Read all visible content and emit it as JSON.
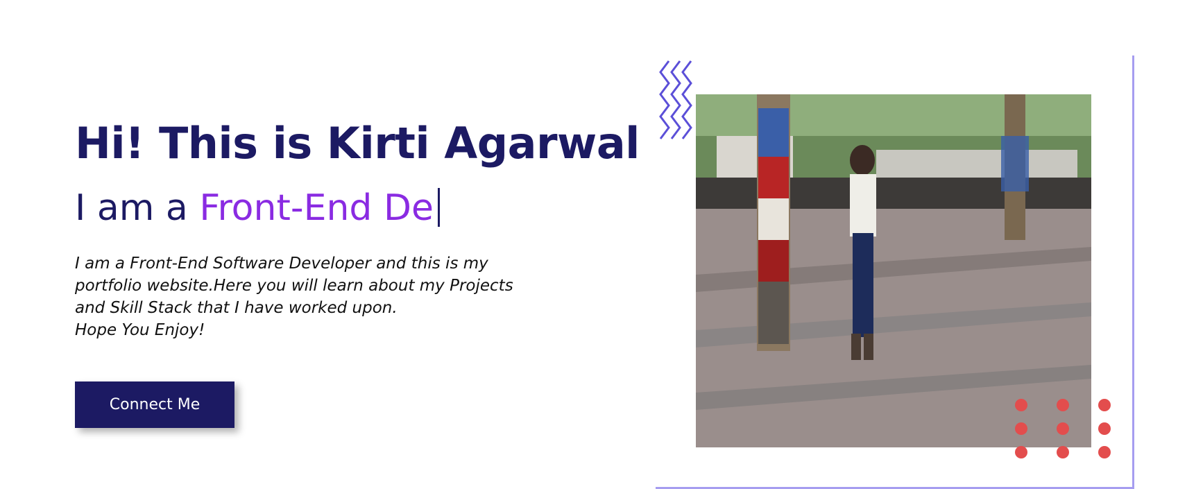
{
  "hero": {
    "title": "Hi! This is Kirti Agarwal",
    "typing_prefix": "I am a ",
    "typing_text": "Front-End De",
    "intro_lines": [
      "I am a Front-End Software Developer and this is my",
      "portfolio website.Here you will learn about my Projects",
      "and Skill Stack that I have worked upon.",
      "Hope You Enjoy!"
    ],
    "cta_label": "Connect Me"
  },
  "colors": {
    "primary": "#1c1a63",
    "accent": "#8a2be2",
    "frame": "#a69df0",
    "zigzag": "#5b4fd8",
    "dots": "#e34d4d"
  },
  "decor": {
    "zigzag_icon": "zigzag-icon",
    "dots_icon": "dot-grid-icon"
  }
}
